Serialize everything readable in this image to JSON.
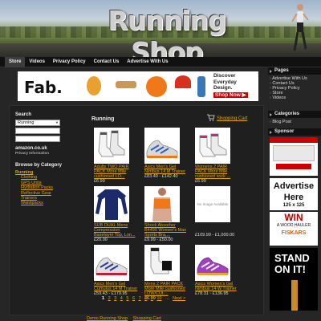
{
  "header": {
    "title": "Running Shop"
  },
  "nav": [
    {
      "label": "Store",
      "active": true
    },
    {
      "label": "Videos"
    },
    {
      "label": "Privacy Policy"
    },
    {
      "label": "Contact Us"
    },
    {
      "label": "Advertise With Us"
    }
  ],
  "banner": {
    "brand": "Fab.",
    "ad_line1": "Discover",
    "ad_line2": "Everyday",
    "ad_line3": "Design.",
    "ad_cta": "Shop Now ▶"
  },
  "left": {
    "search_heading": "Search",
    "search_select": "Running",
    "amazon_label": "amazon.co.uk",
    "amazon_sub": "Privacy Information",
    "browse_heading": "Browse by Category",
    "categories": [
      "Running",
      "Clothing",
      "GPS Units",
      "Hydration Packs",
      "Reflective Gear",
      "Trainers",
      "Waistpacks"
    ]
  },
  "content": {
    "title": "Running",
    "cart_label": "Shopping Cart",
    "products": [
      {
        "name": "Adults TWO PAIR PACK More Mile cushioned LO...",
        "price": "£6.99"
      },
      {
        "name": "Asics Men's Gel Nimbus 14 M Trainer",
        "price": "£83.49 - £142.40"
      },
      {
        "name": "Womens 2 PAIR PACK More Mile cushioned sock ...",
        "price": "£6.99"
      },
      {
        "name": "SUB DUAL Mens Compression Baselayer Top, Lon...",
        "price": "£20.00"
      },
      {
        "name": "Shock Absorber B4490 Women's Max Sports Bra,...",
        "price": "£9.99 - £50.00"
      },
      {
        "name": "",
        "price": "£109.99 - £1,000.00",
        "noimage": "No Image Available"
      },
      {
        "name": "Asics Men's Gel Cumulus 14 M Trainer",
        "price": "£59.43 - £179.95"
      },
      {
        "name": "Mens 2 PAIR PACK More Mile cushioned LOW/CUL...",
        "price": "£6.99"
      },
      {
        "name": "Asics Women's Gel Nimbus 14 W Trainer",
        "price": "£78.31 - £136.95"
      }
    ]
  },
  "pager": {
    "pages": [
      "1",
      "2",
      "3",
      "4",
      "5",
      "6",
      "7",
      "8",
      "9",
      "10"
    ],
    "more": "...",
    "next": "Next >"
  },
  "footer": {
    "link1": "Demo Running Shop",
    "link2": "Shopping Cart"
  },
  "right": {
    "pages_heading": "Pages",
    "pages": [
      "Advertise With Us",
      "Contact Us",
      "Privacy Policy",
      "Store",
      "Videos"
    ],
    "categories_heading": "Categories",
    "categories": [
      "Blog Post"
    ],
    "sponsor_heading": "Sponsor",
    "ad2_line1": "Advertise",
    "ad2_line2": "Here",
    "ad2_line3": "125 x 125",
    "ad3_win": "WIN",
    "ad3_sub": "A WOOD HAULER",
    "ad3_brand": "FISKARS",
    "ad4_line1": "STAND",
    "ad4_line2": "ON IT!"
  },
  "colors": {
    "link": "#e0a400",
    "background": "#262626",
    "nav": "#111111"
  }
}
